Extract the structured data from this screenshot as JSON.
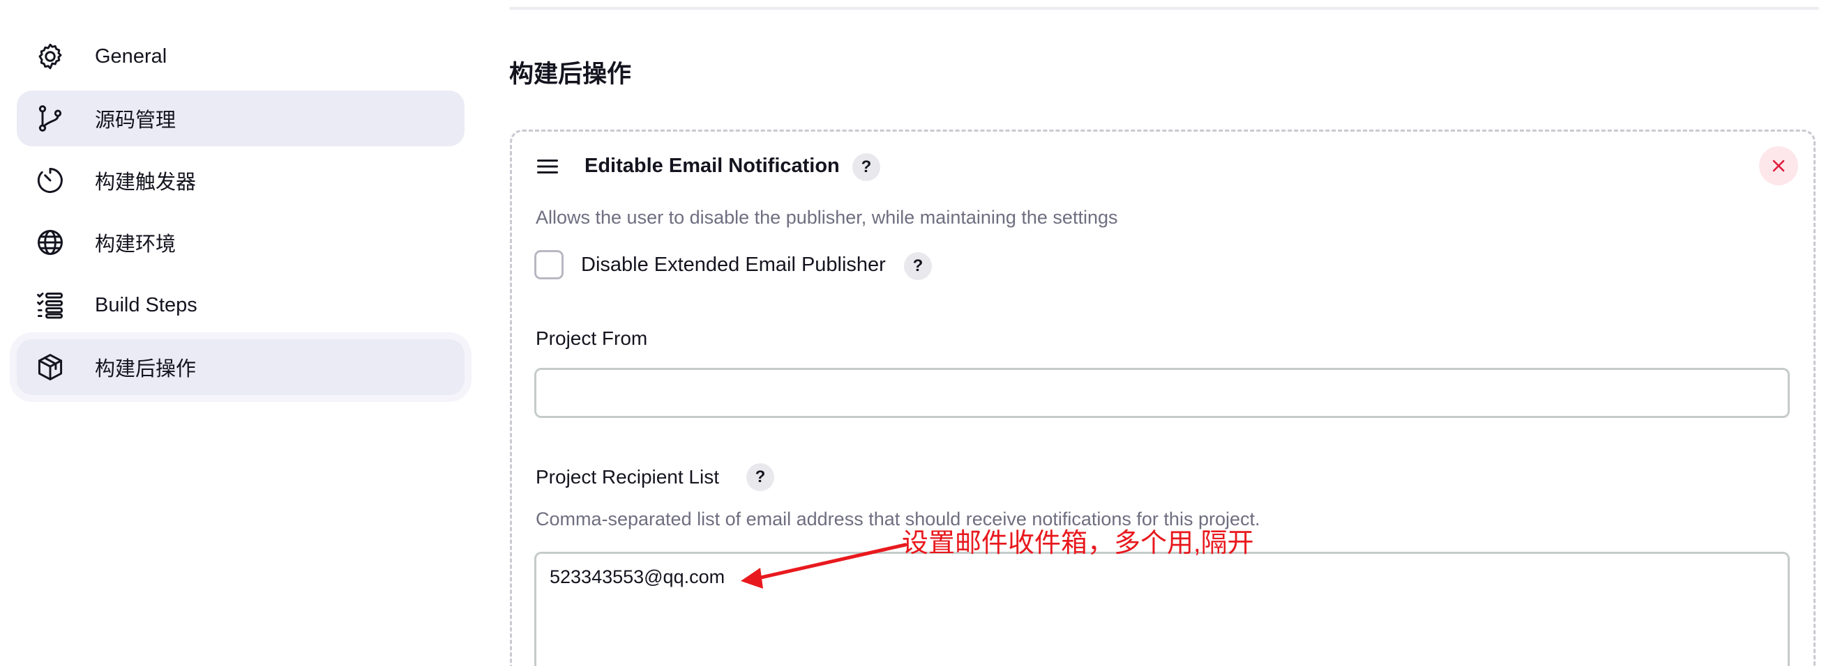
{
  "colors": {
    "selected_bg": "#ebebf5",
    "annotation_red": "#e8191e",
    "close_bg": "#fde7ea",
    "close_icon": "#e01b3c"
  },
  "sidebar": {
    "items": [
      {
        "label": "General",
        "icon": "gear-icon",
        "selected": false
      },
      {
        "label": "源码管理",
        "icon": "branch-icon",
        "selected": true
      },
      {
        "label": "构建触发器",
        "icon": "timer-icon",
        "selected": false
      },
      {
        "label": "构建环境",
        "icon": "globe-icon",
        "selected": false
      },
      {
        "label": "Build Steps",
        "icon": "list-steps-icon",
        "selected": false
      },
      {
        "label": "构建后操作",
        "icon": "package-icon",
        "selected": true
      }
    ]
  },
  "main": {
    "section_title": "构建后操作",
    "card": {
      "title": "Editable Email Notification",
      "help": "?",
      "description": "Allows the user to disable the publisher, while maintaining the settings",
      "disable_checkbox": {
        "label": "Disable Extended Email Publisher",
        "checked": false,
        "help": "?"
      },
      "project_from": {
        "label": "Project From",
        "value": ""
      },
      "recipient_list": {
        "label": "Project Recipient List",
        "help": "?",
        "description": "Comma-separated list of email address that should receive notifications for this project.",
        "value": "523343553@qq.com"
      }
    }
  },
  "annotation": {
    "text": "设置邮件收件箱，多个用,隔开"
  }
}
